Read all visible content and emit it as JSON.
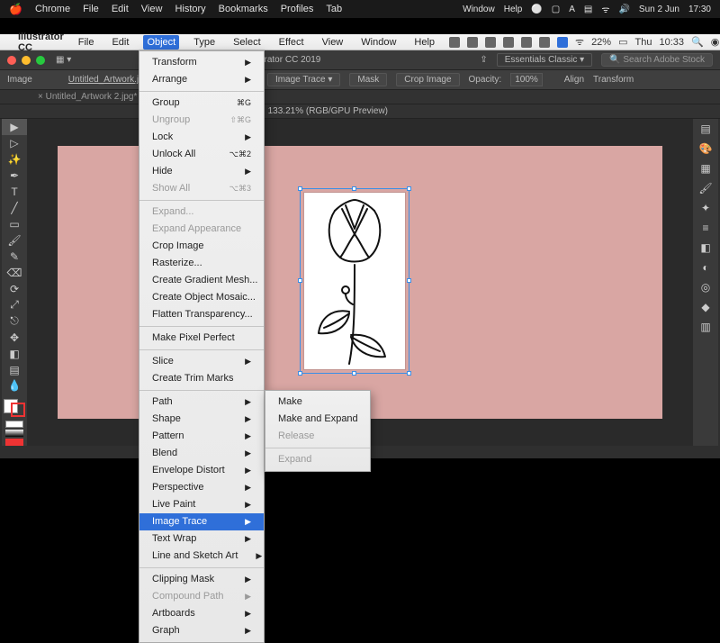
{
  "mac_menubar": {
    "app": "Chrome",
    "items": [
      "File",
      "Edit",
      "View",
      "History",
      "Bookmarks",
      "Profiles",
      "Tab"
    ],
    "right": {
      "window": "Window",
      "help": "Help",
      "date": "Sun 2 Jun",
      "time": "17:30"
    }
  },
  "ai_menubar": {
    "app": "Illustrator CC",
    "items": [
      "File",
      "Edit",
      "Object",
      "Type",
      "Select",
      "Effect",
      "View",
      "Window",
      "Help"
    ],
    "active": "Object",
    "battery": "22%",
    "day": "Thu",
    "time": "10:33"
  },
  "appbar": {
    "title": "Adobe Illustrator CC 2019",
    "workspace": "Essentials Classic",
    "search_placeholder": "Search Adobe Stock"
  },
  "controlbar": {
    "mode": "Image",
    "doc": "Untitled_Artwork.jpg",
    "colormode": "RGB",
    "image_trace": "Image Trace",
    "mask": "Mask",
    "crop": "Crop Image",
    "opacity_label": "Opacity:",
    "opacity_value": "100%",
    "align": "Align",
    "transform": "Transform"
  },
  "tabs": {
    "primary": "Untitled_Artwork 2.jpg*",
    "viewinfo": "Artwork.jpg* @ 133.21% (RGB/GPU Preview)"
  },
  "object_menu": {
    "items": [
      {
        "label": "Transform",
        "sub": true
      },
      {
        "label": "Arrange",
        "sub": true
      },
      {
        "sep": true
      },
      {
        "label": "Group",
        "short": "⌘G"
      },
      {
        "label": "Ungroup",
        "short": "⇧⌘G",
        "disabled": true
      },
      {
        "label": "Lock",
        "sub": true
      },
      {
        "label": "Unlock All",
        "short": "⌥⌘2"
      },
      {
        "label": "Hide",
        "sub": true
      },
      {
        "label": "Show All",
        "short": "⌥⌘3",
        "disabled": true
      },
      {
        "sep": true
      },
      {
        "label": "Expand...",
        "disabled": true
      },
      {
        "label": "Expand Appearance",
        "disabled": true
      },
      {
        "label": "Crop Image"
      },
      {
        "label": "Rasterize..."
      },
      {
        "label": "Create Gradient Mesh..."
      },
      {
        "label": "Create Object Mosaic..."
      },
      {
        "label": "Flatten Transparency..."
      },
      {
        "sep": true
      },
      {
        "label": "Make Pixel Perfect"
      },
      {
        "sep": true
      },
      {
        "label": "Slice",
        "sub": true
      },
      {
        "label": "Create Trim Marks"
      },
      {
        "sep": true
      },
      {
        "label": "Path",
        "sub": true
      },
      {
        "label": "Shape",
        "sub": true
      },
      {
        "label": "Pattern",
        "sub": true
      },
      {
        "label": "Blend",
        "sub": true
      },
      {
        "label": "Envelope Distort",
        "sub": true
      },
      {
        "label": "Perspective",
        "sub": true
      },
      {
        "label": "Live Paint",
        "sub": true
      },
      {
        "label": "Image Trace",
        "sub": true,
        "selected": true
      },
      {
        "label": "Text Wrap",
        "sub": true
      },
      {
        "label": "Line and Sketch Art",
        "sub": true
      },
      {
        "sep": true
      },
      {
        "label": "Clipping Mask",
        "sub": true
      },
      {
        "label": "Compound Path",
        "sub": true,
        "disabled": true
      },
      {
        "label": "Artboards",
        "sub": true
      },
      {
        "label": "Graph",
        "sub": true
      }
    ]
  },
  "image_trace_submenu": {
    "items": [
      {
        "label": "Make"
      },
      {
        "label": "Make and Expand"
      },
      {
        "label": "Release",
        "disabled": true
      },
      {
        "sep": true
      },
      {
        "label": "Expand",
        "disabled": true
      }
    ]
  }
}
